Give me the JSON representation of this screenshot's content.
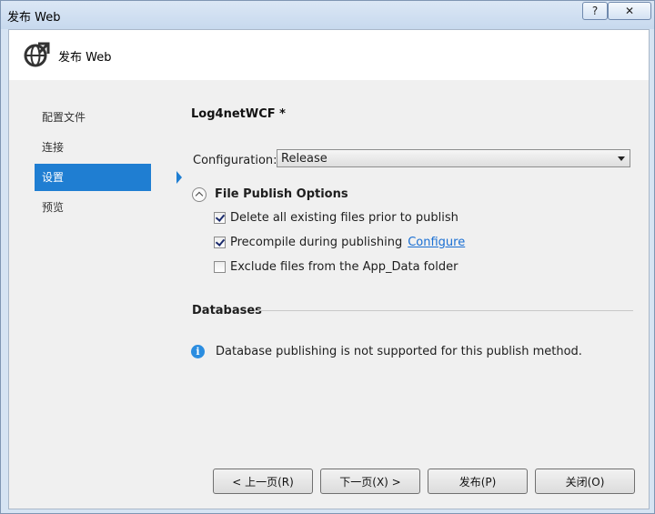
{
  "window": {
    "title": "发布 Web",
    "help_label": "?",
    "close_label": "✕"
  },
  "header": {
    "title": "发布 Web",
    "icon": "globe-arrow-icon"
  },
  "nav": {
    "items": [
      {
        "label": "配置文件",
        "selected": false
      },
      {
        "label": "连接",
        "selected": false
      },
      {
        "label": "设置",
        "selected": true
      },
      {
        "label": "预览",
        "selected": false
      }
    ]
  },
  "settings": {
    "profile_name": "Log4netWCF *",
    "configuration_label": "Configuration:",
    "configuration_value": "Release",
    "file_publish_title": "File Publish Options",
    "options": [
      {
        "label": "Delete all existing files prior to publish",
        "checked": true
      },
      {
        "label": "Precompile during publishing",
        "checked": true,
        "link": "Configure"
      },
      {
        "label": "Exclude files from the App_Data folder",
        "checked": false
      }
    ],
    "databases_title": "Databases",
    "db_info": "Database publishing is not supported for this publish method."
  },
  "buttons": {
    "prev": "< 上一页(R)",
    "next": "下一页(X) >",
    "publish": "发布(P)",
    "close": "关闭(O)"
  },
  "colors": {
    "accent": "#1f7ed2",
    "link": "#1a6fd3",
    "info": "#2b8de0"
  }
}
